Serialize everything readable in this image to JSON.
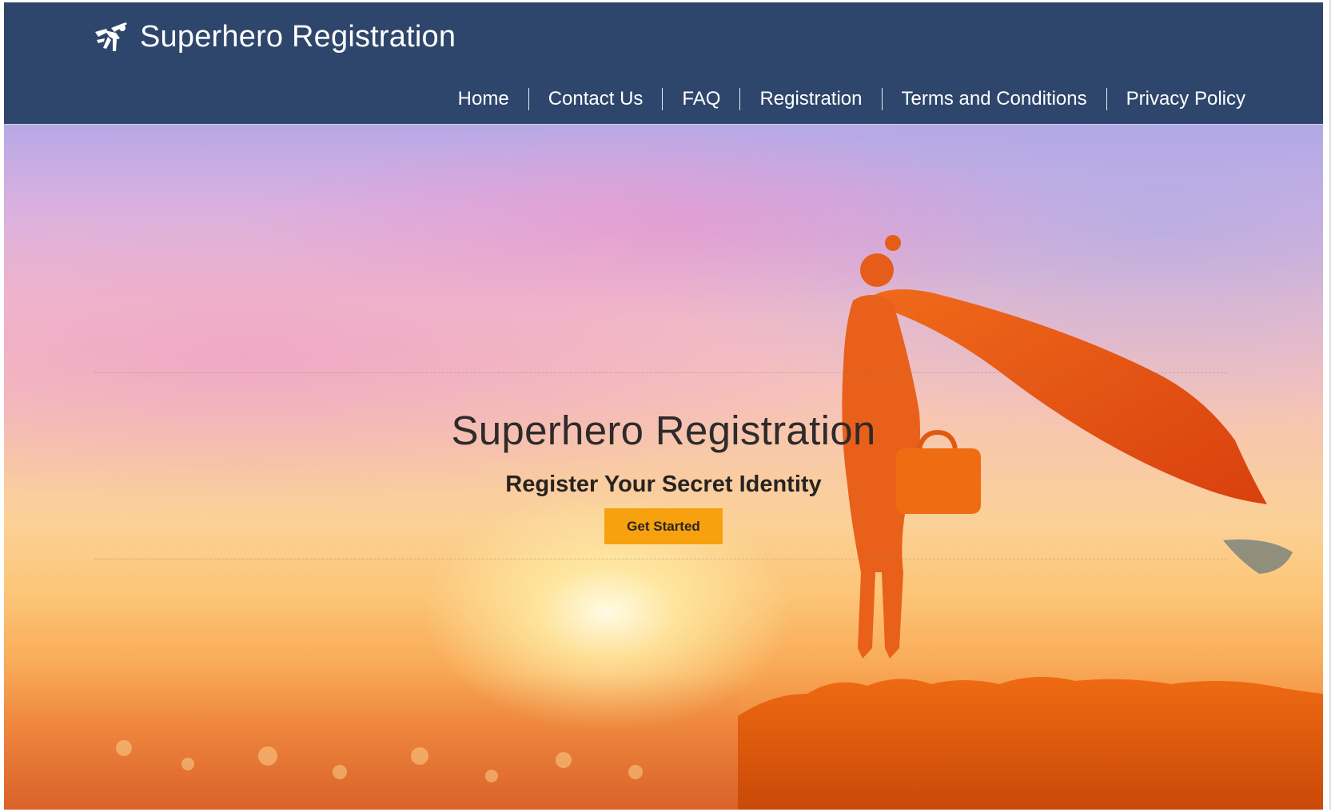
{
  "brand": {
    "title": "Superhero Registration",
    "icon": "flying-superhero-icon"
  },
  "nav": {
    "items": [
      {
        "label": "Home"
      },
      {
        "label": "Contact Us"
      },
      {
        "label": "FAQ"
      },
      {
        "label": "Registration"
      },
      {
        "label": "Terms and Conditions"
      },
      {
        "label": "Privacy Policy"
      }
    ]
  },
  "hero": {
    "title": "Superhero Registration",
    "subtitle": "Register Your Secret Identity",
    "cta_label": "Get Started",
    "background": "sunset-sky-with-caped-hero-silhouette"
  },
  "colors": {
    "header_bg": "#2f466c",
    "cta_bg": "#f6a10d",
    "hero_text": "#2e2b2a"
  }
}
